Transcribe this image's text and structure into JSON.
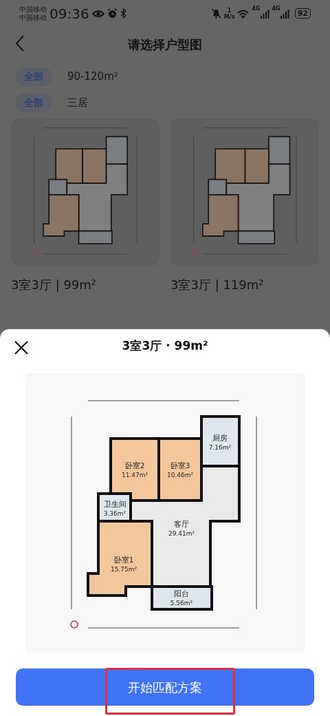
{
  "status_bar": {
    "carriers": [
      "中国移动",
      "中国移动"
    ],
    "time": "09:36",
    "speed_value": "1",
    "speed_unit": "M/s",
    "signal_labels": [
      "4G",
      "4G"
    ],
    "battery": "92"
  },
  "header": {
    "title": "请选择户型图"
  },
  "filters": [
    {
      "chip": "全部",
      "value": "90-120m²"
    },
    {
      "chip": "全部",
      "value": "三居"
    }
  ],
  "layouts": [
    {
      "caption": "3室3厅 | 99m²"
    },
    {
      "caption": "3室3厅 | 119m²"
    }
  ],
  "sheet": {
    "title": "3室3厅 · 99m²",
    "rooms": [
      {
        "name": "卧室2",
        "area": "11.47m²",
        "kind": "bedroom"
      },
      {
        "name": "卧室3",
        "area": "10.46m²",
        "kind": "bedroom"
      },
      {
        "name": "厨房",
        "area": "7.16m²",
        "kind": "tile"
      },
      {
        "name": "卫生间",
        "area": "3.36m²",
        "kind": "tile"
      },
      {
        "name": "客厅",
        "area": "29.41m²",
        "kind": "living"
      },
      {
        "name": "卧室1",
        "area": "15.75m²",
        "kind": "bedroom"
      },
      {
        "name": "阳台",
        "area": "5.56m²",
        "kind": "tile"
      }
    ],
    "button": "开始匹配方案",
    "highlighted": true
  }
}
